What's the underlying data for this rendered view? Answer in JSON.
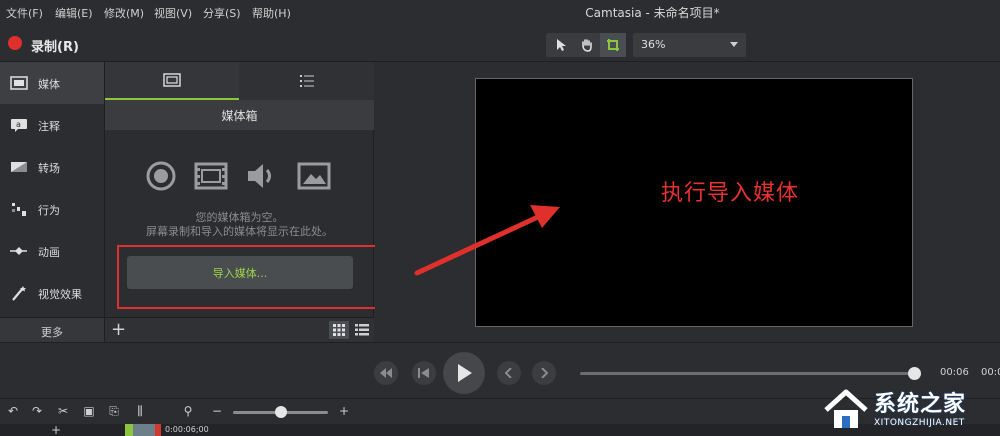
{
  "menu": {
    "items": [
      "文件(F)",
      "编辑(E)",
      "修改(M)",
      "视图(V)",
      "分享(S)",
      "帮助(H)"
    ],
    "title": "Camtasia - 未命名项目*"
  },
  "record": {
    "label": "录制(R)",
    "color": "#e0302c"
  },
  "toolbar": {
    "zoom": "36%"
  },
  "nav": {
    "items": [
      {
        "label": "媒体",
        "icon": "film-icon"
      },
      {
        "label": "注释",
        "icon": "callout-icon"
      },
      {
        "label": "转场",
        "icon": "transition-icon"
      },
      {
        "label": "行为",
        "icon": "behavior-icon"
      },
      {
        "label": "动画",
        "icon": "animation-icon"
      },
      {
        "label": "视觉效果",
        "icon": "magic-wand-icon"
      }
    ],
    "more": "更多"
  },
  "media_bin": {
    "header": "媒体箱",
    "empty_line1": "您的媒体箱为空。",
    "empty_line2": "屏幕录制和导入的媒体将显示在此处。",
    "import_button": "导入媒体..."
  },
  "canvas": {
    "annotation": "执行导入媒体",
    "annotation_color": "#e8322f"
  },
  "playback": {
    "current_time": "00:06",
    "end_time": "00:0",
    "progress": 0.98
  },
  "timeline": {
    "playhead_time": "0:00:06;00",
    "zoom_level": 0.5
  },
  "watermark": {
    "title": "系统之家",
    "subtitle": "XITONGZHIJIA.NET"
  },
  "colors": {
    "accent": "#8cc63f",
    "background": "#2b2d30"
  }
}
